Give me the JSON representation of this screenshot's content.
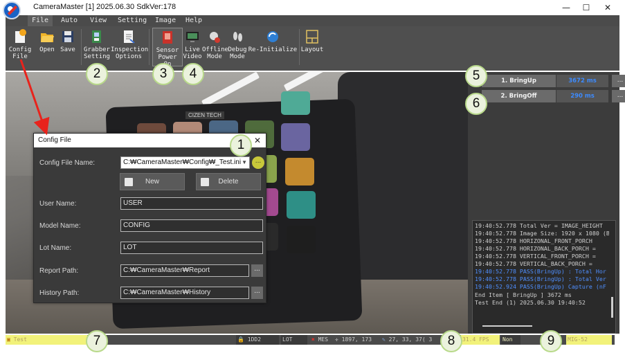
{
  "window": {
    "title": "CameraMaster [1] 2025.06.30 SdkVer:178",
    "controls": [
      "—",
      "☐",
      "✕"
    ]
  },
  "menu": [
    "File",
    "Auto",
    "View",
    "Setting",
    "Image",
    "Help"
  ],
  "toolbar": {
    "config_file": [
      "Config",
      "File"
    ],
    "open": "Open",
    "save": "Save",
    "grabber_setting": [
      "Grabber",
      "Setting"
    ],
    "inspection_options": [
      "Inspection",
      "Options"
    ],
    "sensor_power_on": [
      "Sensor",
      "Power On"
    ],
    "live_video": [
      "Live",
      "Video"
    ],
    "offline_mode": [
      "Offline",
      "Mode"
    ],
    "debug_mode": [
      "Debug",
      "Mode"
    ],
    "reinitialize": "Re-Initialize",
    "layout": "Layout"
  },
  "viewport": {
    "panel_label": "CIZEN TECH",
    "panel_label_side": "CIZEN TECH"
  },
  "sequence": [
    {
      "name": "1. BringUp",
      "time": "3672 ms",
      "more": "..."
    },
    {
      "name": "2. BringOff",
      "time": "290 ms",
      "more": "..."
    }
  ],
  "log": [
    {
      "text": "19:40:52.778  Total Ver = IMAGE_HEIGHT",
      "type": "info"
    },
    {
      "text": "19:40:52.778  Image Size: 1920 x 1080 (B",
      "type": "info"
    },
    {
      "text": "19:40:52.778  HORIZONAL_FRONT_PORCH",
      "type": "info"
    },
    {
      "text": "19:40:52.778  HORIZONAL_BACK_PORCH =",
      "type": "info"
    },
    {
      "text": "19:40:52.778  VERTICAL_FRONT_PORCH =",
      "type": "info"
    },
    {
      "text": "19:40:52.778  VERTICAL_BACK_PORCH =",
      "type": "info"
    },
    {
      "text": "19:40:52.778  PASS(BringUp) : Total Hor",
      "type": "pass"
    },
    {
      "text": "19:40:52.778  PASS(BringUp) : Total Ver",
      "type": "pass"
    },
    {
      "text": "19:40:52.924  PASS(BringUp) Capture (nF",
      "type": "pass"
    },
    {
      "text": "End Item     [ BringUp ]     3672 ms",
      "type": "info"
    },
    {
      "text": "Test End     (1) 2025.06.30 19:40:52",
      "type": "info"
    }
  ],
  "status": {
    "test": "Test",
    "id": "1DD2",
    "lot": "LOT",
    "mes": "MES",
    "coords": "1897, 173",
    "pixel": "27, 33, 37( 3",
    "fps": "31.4 FPS",
    "mode": "Non",
    "model": "MIG-52"
  },
  "config_dialog": {
    "title": "Config File",
    "close": "✕",
    "config_file_name_label": "Config File Name:",
    "config_file_name_value": "C:₩CameraMaster₩Config₩_Test.ini",
    "browse": "...",
    "new_label": "New",
    "delete_label": "Delete",
    "user_name_label": "User Name:",
    "user_name_value": "USER",
    "model_name_label": "Model Name:",
    "model_name_value": "CONFIG",
    "lot_name_label": "Lot Name:",
    "lot_name_value": "LOT",
    "report_path_label": "Report Path:",
    "report_path_value": "C:₩CameraMaster₩Report",
    "history_path_label": "History Path:",
    "history_path_value": "C:₩CameraMaster₩History"
  },
  "annotations": [
    "1",
    "2",
    "3",
    "4",
    "5",
    "6",
    "7",
    "8",
    "9"
  ],
  "colors": {
    "annotation_fill": "#ebf2dd",
    "annotation_border": "#b8d98a",
    "arrow": "#e8231c",
    "pass_log": "#4f8fff",
    "step_time": "#3d8bff",
    "status_highlight": "#f2f27a"
  }
}
